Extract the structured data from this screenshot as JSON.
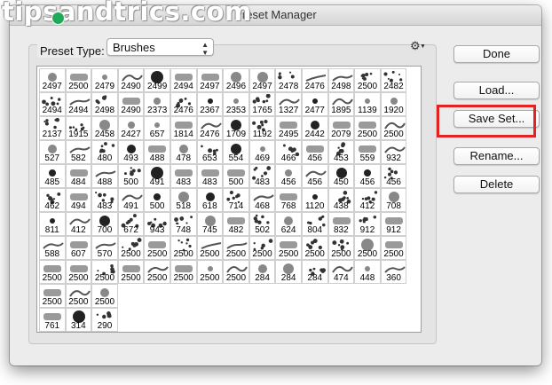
{
  "watermark": {
    "text": "tipsandtrics.com"
  },
  "window": {
    "title": "Preset Manager"
  },
  "preset_type": {
    "label": "Preset Type:",
    "value": "Brushes"
  },
  "buttons": {
    "done": "Done",
    "load": "Load...",
    "save_set": "Save Set...",
    "rename": "Rename...",
    "delete": "Delete"
  },
  "icons": {
    "gear": "gear-icon",
    "popup_arrows": "updown-arrows-icon"
  },
  "colors": {
    "highlight": "#e52222",
    "selection": "#2b6fd6",
    "window_bg": "#ececec"
  },
  "brush_sizes": [
    [
      "2497",
      "2500",
      "2479",
      "2490",
      "2499",
      "2494",
      "2497",
      "2496",
      "2497",
      "2478",
      "2476",
      "2498",
      "2500",
      "2482"
    ],
    [
      "2494",
      "2494",
      "2498",
      "2490",
      "2373",
      "2476",
      "2367",
      "2353",
      "1765",
      "1327",
      "2477",
      "1895",
      "1139",
      "1920"
    ],
    [
      "2137",
      "1915",
      "2458",
      "2427",
      "657",
      "1814",
      "2476",
      "1709",
      "1192",
      "2495",
      "2442",
      "2079",
      "2500",
      "2500"
    ],
    [
      "527",
      "582",
      "480",
      "493",
      "488",
      "478",
      "653",
      "554",
      "469",
      "466",
      "456",
      "453",
      "559",
      "932"
    ],
    [
      "485",
      "484",
      "488",
      "500",
      "491",
      "483",
      "483",
      "500",
      "483",
      "456",
      "456",
      "450",
      "456",
      "456"
    ],
    [
      "462",
      "494",
      "483",
      "491",
      "500",
      "518",
      "618",
      "714",
      "468",
      "768",
      "1120",
      "438",
      "412",
      "708"
    ],
    [
      "811",
      "412",
      "700",
      "672",
      "943",
      "748",
      "745",
      "482",
      "502",
      "624",
      "804",
      "832",
      "912",
      "912"
    ],
    [
      "588",
      "607",
      "570",
      "2500",
      "2500",
      "2500",
      "2500",
      "2500",
      "2500",
      "2500",
      "2500",
      "2500",
      "2500",
      "2500"
    ],
    [
      "2500",
      "2500",
      "2500",
      "2500",
      "2500",
      "2500",
      "2500",
      "2500",
      "284",
      "284",
      "284",
      "474",
      "448",
      "360"
    ],
    [
      "2500",
      "2500",
      "2500"
    ],
    [
      "761",
      "314",
      "290"
    ]
  ],
  "selected_index": 139
}
